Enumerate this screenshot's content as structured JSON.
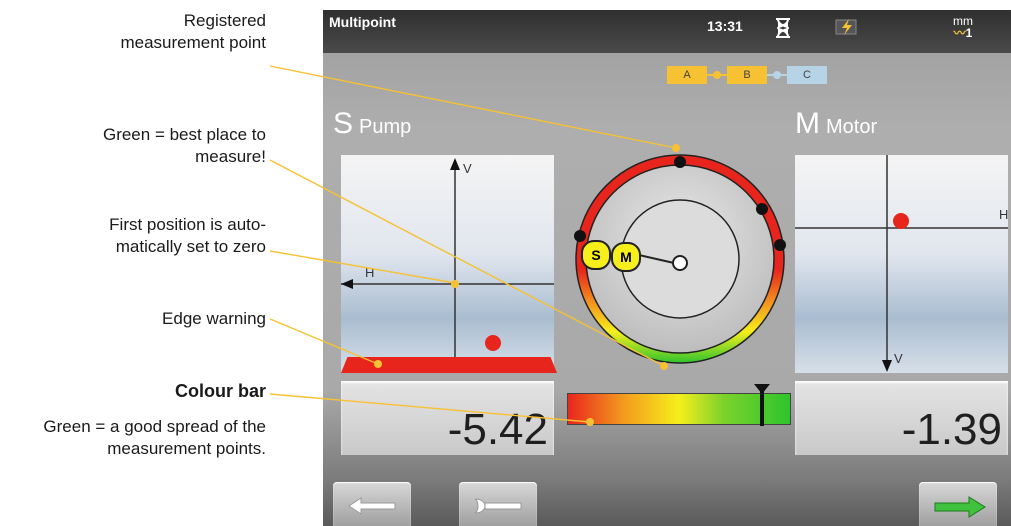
{
  "annotations": {
    "registered": "Registered\nmeasurement point",
    "green_best": "Green = best place to\nmeasure!",
    "first_position": "First position is auto-\nmatically set to zero",
    "edge_warning": "Edge warning",
    "colour_bar_title": "Colour bar",
    "colour_bar_desc": "Green = a good spread of the\nmeasurement points."
  },
  "status": {
    "title": "Multipoint",
    "time": "13:31",
    "unit": "mm",
    "unit_sub": "1",
    "icons": [
      "hourglass-icon",
      "battery-charging-icon",
      "unit-resolution-icon"
    ]
  },
  "steps": [
    {
      "label": "A",
      "state": "done"
    },
    {
      "label": "B",
      "state": "done"
    },
    {
      "label": "C",
      "state": "todo"
    }
  ],
  "pump": {
    "letter": "S",
    "name": "Pump",
    "value": "-5.42",
    "v_axis": "V",
    "h_axis": "H"
  },
  "motor": {
    "letter": "M",
    "name": "Motor",
    "value": "-1.39",
    "v_axis": "V",
    "h_axis": "H"
  },
  "dial": {
    "s_label": "S",
    "m_label": "M"
  },
  "colour_bar": {
    "level": 0.87
  },
  "colors": {
    "red": "#e8251c",
    "green": "#2fc42d",
    "yellow": "#f6c132",
    "lead_line": "#f6c132"
  }
}
